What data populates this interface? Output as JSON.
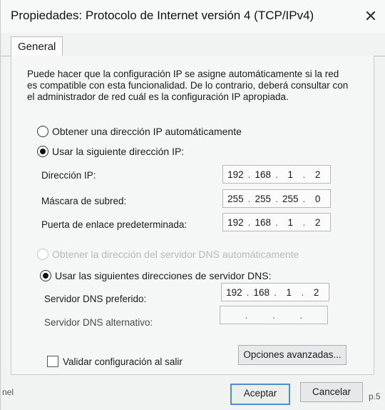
{
  "window": {
    "title": "Propiedades: Protocolo de Internet versión 4 (TCP/IPv4)",
    "close_glyph": "✕"
  },
  "tabs": [
    {
      "label": "General"
    }
  ],
  "intro_text": "Puede hacer que la configuración IP se asigne automáticamente si la red es compatible con esta funcionalidad. De lo contrario, deberá consultar con el administrador de red cuál es la configuración IP apropiada.",
  "ip_section": {
    "auto_option": "Obtener una dirección IP automáticamente",
    "manual_option": "Usar la siguiente dirección IP:",
    "selected": "manual",
    "fields": [
      {
        "label": "Dirección IP:",
        "octets": [
          "192",
          "168",
          "1",
          "2"
        ]
      },
      {
        "label": "Máscara de subred:",
        "octets": [
          "255",
          "255",
          "255",
          "0"
        ]
      },
      {
        "label": "Puerta de enlace predeterminada:",
        "octets": [
          "192",
          "168",
          "1",
          "2"
        ]
      }
    ]
  },
  "dns_section": {
    "auto_option": "Obtener la dirección del servidor DNS automáticamente",
    "manual_option": "Usar las siguientes direcciones de servidor DNS:",
    "selected": "manual",
    "fields": [
      {
        "label": "Servidor DNS preferido:",
        "octets": [
          "192",
          "168",
          "1",
          "2"
        ]
      },
      {
        "label": "Servidor DNS alternativo:",
        "octets": [
          "",
          "",
          "",
          ""
        ]
      }
    ]
  },
  "validate_checkbox": {
    "label": "Validar configuración al salir",
    "checked": false
  },
  "buttons": {
    "advanced": "Opciones avanzadas...",
    "ok": "Aceptar",
    "cancel": "Cancelar"
  },
  "background_fragments": {
    "left": "nel",
    "right": "p.5"
  }
}
